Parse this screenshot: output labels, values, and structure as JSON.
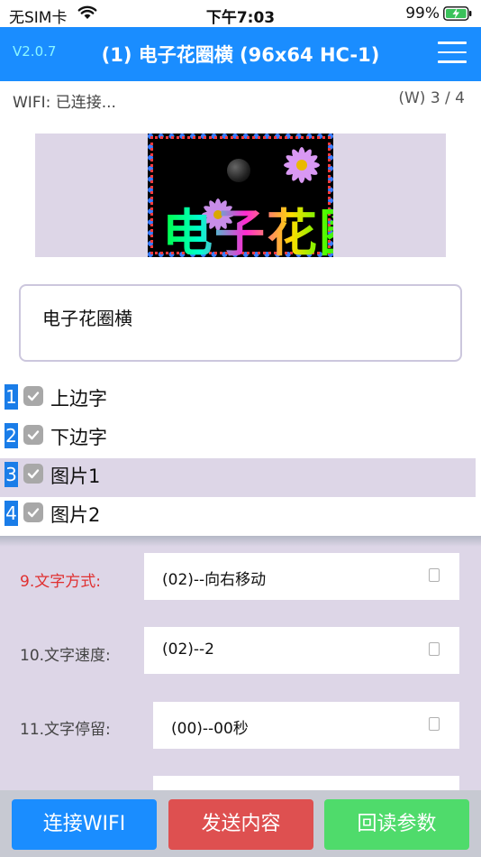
{
  "status_bar": {
    "carrier": "无SIM卡",
    "time": "下午7:03",
    "battery": "99%"
  },
  "header": {
    "version": "V2.0.7",
    "title": "(1) 电子花圈横 (96x64 HC-1)"
  },
  "connection": {
    "wifi_status": "WIFI: 已连接...",
    "page_counter": "(W) 3 / 4"
  },
  "preview": {
    "led_text": "电子花圈"
  },
  "text_input": {
    "value": "电子花圈横"
  },
  "items": [
    {
      "index": "1",
      "label": "上边字",
      "checked": true,
      "selected": false
    },
    {
      "index": "2",
      "label": "下边字",
      "checked": true,
      "selected": false
    },
    {
      "index": "3",
      "label": "图片1",
      "checked": true,
      "selected": true
    },
    {
      "index": "4",
      "label": "图片2",
      "checked": true,
      "selected": false
    }
  ],
  "settings": [
    {
      "label": "9.文字方式:",
      "value": "(02)--向右移动",
      "highlight": true
    },
    {
      "label": "10.文字速度:",
      "value": "(02)--2",
      "highlight": false
    },
    {
      "label": "11.文字停留:",
      "value": "(00)--00秒",
      "highlight": false
    }
  ],
  "actions": {
    "connect_wifi": "连接WIFI",
    "send_content": "发送内容",
    "read_params": "回读参数"
  },
  "colors": {
    "header": "#1a8dff",
    "connect": "#1a8dff",
    "send": "#de5050",
    "read": "#4fdb6b",
    "index_badge": "#1a7de8",
    "highlight_label": "#e03030"
  }
}
